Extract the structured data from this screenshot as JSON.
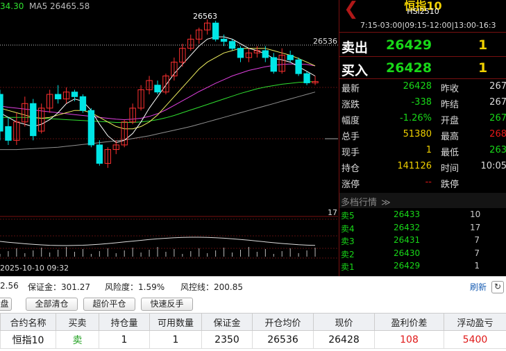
{
  "colors": {
    "up": "#ff3030",
    "down": "#00e5e5",
    "ma5": "#ffffff",
    "ma10": "#f0f060",
    "ma20": "#e040e0",
    "ma30": "#30e030",
    "ma60": "#909090",
    "green": "#18d818",
    "red": "#e81818",
    "yellow": "#f0d000"
  },
  "chart": {
    "ma_prefix": "34.30",
    "ma5_label": "MA5 26465.58",
    "high_label": "26563",
    "ref_price_label": "26536",
    "volume_axis_label": "17",
    "timestamp": "2025-10-10 09:32"
  },
  "chart_data": {
    "type": "candlestick",
    "candles": [
      {
        "o": 26400,
        "c": 26320,
        "h": 26410,
        "l": 26300
      },
      {
        "o": 26330,
        "c": 26300,
        "h": 26350,
        "l": 26290
      },
      {
        "o": 26300,
        "c": 26340,
        "h": 26360,
        "l": 26290
      },
      {
        "o": 26340,
        "c": 26380,
        "h": 26395,
        "l": 26330
      },
      {
        "o": 26380,
        "c": 26310,
        "h": 26390,
        "l": 26300
      },
      {
        "o": 26320,
        "c": 26370,
        "h": 26380,
        "l": 26315
      },
      {
        "o": 26370,
        "c": 26400,
        "h": 26410,
        "l": 26360
      },
      {
        "o": 26400,
        "c": 26390,
        "h": 26420,
        "l": 26380
      },
      {
        "o": 26390,
        "c": 26405,
        "h": 26415,
        "l": 26380
      },
      {
        "o": 26405,
        "c": 26395,
        "h": 26410,
        "l": 26385
      },
      {
        "o": 26395,
        "c": 26365,
        "h": 26400,
        "l": 26360
      },
      {
        "o": 26365,
        "c": 26290,
        "h": 26370,
        "l": 26285
      },
      {
        "o": 26290,
        "c": 26250,
        "h": 26300,
        "l": 26245
      },
      {
        "o": 26250,
        "c": 26280,
        "h": 26285,
        "l": 26240
      },
      {
        "o": 26280,
        "c": 26290,
        "h": 26300,
        "l": 26270
      },
      {
        "o": 26290,
        "c": 26340,
        "h": 26345,
        "l": 26285
      },
      {
        "o": 26340,
        "c": 26370,
        "h": 26380,
        "l": 26335
      },
      {
        "o": 26370,
        "c": 26410,
        "h": 26420,
        "l": 26365
      },
      {
        "o": 26410,
        "c": 26430,
        "h": 26440,
        "l": 26400
      },
      {
        "o": 26420,
        "c": 26405,
        "h": 26430,
        "l": 26400
      },
      {
        "o": 26405,
        "c": 26440,
        "h": 26445,
        "l": 26400
      },
      {
        "o": 26440,
        "c": 26470,
        "h": 26480,
        "l": 26430
      },
      {
        "o": 26470,
        "c": 26500,
        "h": 26510,
        "l": 26460
      },
      {
        "o": 26500,
        "c": 26520,
        "h": 26530,
        "l": 26495
      },
      {
        "o": 26520,
        "c": 26540,
        "h": 26545,
        "l": 26510
      },
      {
        "o": 26540,
        "c": 26555,
        "h": 26563,
        "l": 26530
      },
      {
        "o": 26555,
        "c": 26520,
        "h": 26560,
        "l": 26515
      },
      {
        "o": 26520,
        "c": 26515,
        "h": 26530,
        "l": 26505
      },
      {
        "o": 26515,
        "c": 26500,
        "h": 26520,
        "l": 26495
      },
      {
        "o": 26500,
        "c": 26480,
        "h": 26505,
        "l": 26470
      },
      {
        "o": 26480,
        "c": 26490,
        "h": 26500,
        "l": 26470
      },
      {
        "o": 26490,
        "c": 26495,
        "h": 26505,
        "l": 26480
      },
      {
        "o": 26495,
        "c": 26480,
        "h": 26505,
        "l": 26470
      },
      {
        "o": 26480,
        "c": 26450,
        "h": 26490,
        "l": 26445
      },
      {
        "o": 26450,
        "c": 26485,
        "h": 26500,
        "l": 26445
      },
      {
        "o": 26485,
        "c": 26475,
        "h": 26495,
        "l": 26470
      },
      {
        "o": 26475,
        "c": 26445,
        "h": 26480,
        "l": 26440
      },
      {
        "o": 26445,
        "c": 26425,
        "h": 26450,
        "l": 26420
      },
      {
        "o": 26425,
        "c": 26428,
        "h": 26440,
        "l": 26420
      }
    ],
    "ma5": [
      26360,
      26350,
      26340,
      26335,
      26330,
      26335,
      26345,
      26360,
      26380,
      26390,
      26385,
      26365,
      26335,
      26310,
      26295,
      26300,
      26315,
      26340,
      26370,
      26395,
      26420,
      26445,
      26465,
      26485,
      26505,
      26520,
      26525,
      26525,
      26520,
      26510,
      26500,
      26495,
      26488,
      26478,
      26475,
      26470,
      26460,
      26450,
      26440
    ],
    "ma10": [
      26370,
      26365,
      26360,
      26355,
      26350,
      26348,
      26350,
      26355,
      26360,
      26365,
      26365,
      26360,
      26350,
      26340,
      26330,
      26325,
      26325,
      26330,
      26340,
      26355,
      26375,
      26395,
      26415,
      26435,
      26455,
      26470,
      26480,
      26490,
      26495,
      26500,
      26500,
      26500,
      26500,
      26495,
      26490,
      26485,
      26478,
      26470,
      26462
    ],
    "ma20": [
      26375,
      26372,
      26370,
      26368,
      26366,
      26364,
      26362,
      26360,
      26358,
      26356,
      26354,
      26352,
      26350,
      26348,
      26346,
      26345,
      26346,
      26348,
      26352,
      26358,
      26366,
      26376,
      26386,
      26396,
      26406,
      26415,
      26424,
      26432,
      26440,
      26446,
      26452,
      26456,
      26460,
      26463,
      26465,
      26466,
      26466,
      26465,
      26462
    ],
    "ma30": [
      26350,
      26350,
      26350,
      26350,
      26349,
      26348,
      26347,
      26346,
      26345,
      26344,
      26343,
      26342,
      26341,
      26340,
      26339,
      26339,
      26339,
      26340,
      26342,
      26345,
      26349,
      26354,
      26360,
      26366,
      26372,
      26378,
      26384,
      26390,
      26396,
      26402,
      26407,
      26412,
      26416,
      26419,
      26422,
      26424,
      26426,
      26427,
      26428
    ],
    "ma60": [
      26280,
      26280,
      26280,
      26281,
      26282,
      26283,
      26284,
      26285,
      26287,
      26289,
      26291,
      26293,
      26295,
      26297,
      26299,
      26301,
      26304,
      26307,
      26310,
      26314,
      26318,
      26322,
      26326,
      26330,
      26335,
      26340,
      26345,
      26350,
      26355,
      26360,
      26365,
      26370,
      26375,
      26380,
      26385,
      26390,
      26395,
      26400,
      26405
    ],
    "ylim": [
      26210,
      26590
    ]
  },
  "panel": {
    "title": "恒指10",
    "code": "HSI2510",
    "hours": "7:15-03:00|09:15-12:00|13:00-16:3",
    "sell_label": "卖出",
    "sell_price": "26429",
    "sell_vol": "1",
    "buy_label": "买入",
    "buy_price": "26428",
    "buy_vol": "1",
    "stats_left": [
      {
        "label": "最新",
        "value": "26428",
        "color": "green"
      },
      {
        "label": "涨跌",
        "value": "-338",
        "color": "green"
      },
      {
        "label": "幅度",
        "value": "-1.26%",
        "color": "green"
      },
      {
        "label": "总手",
        "value": "51380",
        "color": "yellow"
      },
      {
        "label": "现手",
        "value": "1",
        "color": "yellow"
      },
      {
        "label": "持仓",
        "value": "141126",
        "color": "yellow"
      },
      {
        "label": "涨停",
        "value": "--",
        "color": "red"
      }
    ],
    "stats_right": [
      {
        "label": "昨收",
        "value": "267",
        "color": "white"
      },
      {
        "label": "昨结",
        "value": "267",
        "color": "white"
      },
      {
        "label": "开盘",
        "value": "267",
        "color": "green"
      },
      {
        "label": "最高",
        "value": "268",
        "color": "red"
      },
      {
        "label": "最低",
        "value": "263",
        "color": "green"
      },
      {
        "label": "时间",
        "value": "10:05",
        "color": "white"
      },
      {
        "label": "跌停",
        "value": "",
        "color": "white"
      }
    ],
    "depth_title": "多档行情",
    "depth": [
      {
        "label": "卖5",
        "price": "26433",
        "vol": "10"
      },
      {
        "label": "卖4",
        "price": "26432",
        "vol": "17"
      },
      {
        "label": "卖3",
        "price": "26431",
        "vol": "7"
      },
      {
        "label": "卖2",
        "price": "26430",
        "vol": "7"
      },
      {
        "label": "卖1",
        "price": "26429",
        "vol": "1"
      }
    ]
  },
  "account": {
    "balance_tail": "2.56",
    "margin": "保证金：301.27",
    "risk": "风险度：1.59%",
    "risk_line": "风控线：200.85",
    "refresh": "刷新"
  },
  "toolbar": {
    "close_tab": "盘",
    "close_all": "全部清仓",
    "over_price_close": "超价平仓",
    "reverse": "快速反手"
  },
  "positions": {
    "headers": [
      "合约名称",
      "买卖",
      "持仓量",
      "可用数量",
      "保证金",
      "开仓均价",
      "现价",
      "盈利价差",
      "浮动盈亏"
    ],
    "rows": [
      [
        "恒指10",
        "卖",
        "1",
        "1",
        "2350",
        "26536",
        "26428",
        "108",
        "5400"
      ]
    ]
  }
}
